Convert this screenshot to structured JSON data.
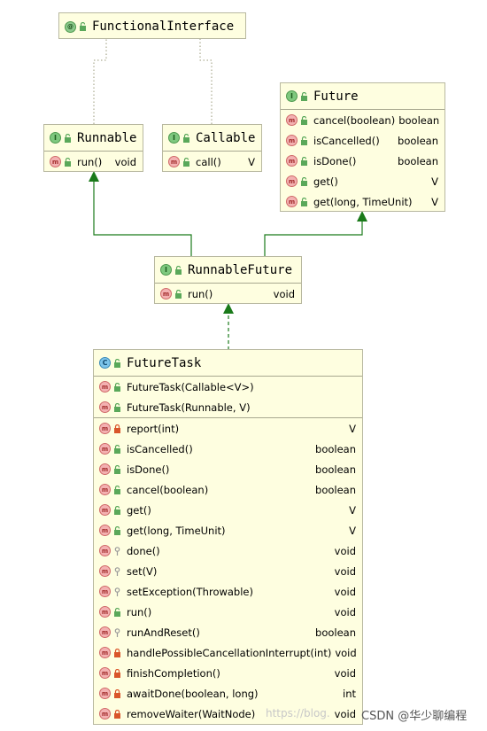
{
  "functional_interface": {
    "title": "FunctionalInterface"
  },
  "runnable": {
    "title": "Runnable",
    "methods": [
      {
        "name": "run()",
        "type": "void"
      }
    ]
  },
  "callable": {
    "title": "Callable",
    "methods": [
      {
        "name": "call()",
        "type": "V"
      }
    ]
  },
  "future": {
    "title": "Future",
    "methods": [
      {
        "name": "cancel(boolean)",
        "type": "boolean"
      },
      {
        "name": "isCancelled()",
        "type": "boolean"
      },
      {
        "name": "isDone()",
        "type": "boolean"
      },
      {
        "name": "get()",
        "type": "V"
      },
      {
        "name": "get(long, TimeUnit)",
        "type": "V"
      }
    ]
  },
  "runnable_future": {
    "title": "RunnableFuture",
    "methods": [
      {
        "name": "run()",
        "type": "void"
      }
    ]
  },
  "future_task": {
    "title": "FutureTask",
    "constructors": [
      {
        "name": "FutureTask(Callable<V>)"
      },
      {
        "name": "FutureTask(Runnable, V)"
      }
    ],
    "methods": [
      {
        "name": "report(int)",
        "type": "V",
        "visibility": "private"
      },
      {
        "name": "isCancelled()",
        "type": "boolean",
        "visibility": "public"
      },
      {
        "name": "isDone()",
        "type": "boolean",
        "visibility": "public"
      },
      {
        "name": "cancel(boolean)",
        "type": "boolean",
        "visibility": "public"
      },
      {
        "name": "get()",
        "type": "V",
        "visibility": "public"
      },
      {
        "name": "get(long, TimeUnit)",
        "type": "V",
        "visibility": "public"
      },
      {
        "name": "done()",
        "type": "void",
        "visibility": "protected"
      },
      {
        "name": "set(V)",
        "type": "void",
        "visibility": "protected"
      },
      {
        "name": "setException(Throwable)",
        "type": "void",
        "visibility": "protected"
      },
      {
        "name": "run()",
        "type": "void",
        "visibility": "public"
      },
      {
        "name": "runAndReset()",
        "type": "boolean",
        "visibility": "protected"
      },
      {
        "name": "handlePossibleCancellationInterrupt(int)",
        "type": "void",
        "visibility": "private"
      },
      {
        "name": "finishCompletion()",
        "type": "void",
        "visibility": "private"
      },
      {
        "name": "awaitDone(boolean, long)",
        "type": "int",
        "visibility": "private"
      },
      {
        "name": "removeWaiter(WaitNode)",
        "type": "void",
        "visibility": "private"
      }
    ]
  },
  "watermark": {
    "url": "https://blog.",
    "csdn": "CSDN @华少聊编程"
  },
  "icons": {
    "interface": "I",
    "class": "C",
    "annotation": "@",
    "method": "m"
  },
  "colors": {
    "box_fill": "#fefee0",
    "edge": "#1a7a1a",
    "annotation_link": "#9a9a7a"
  }
}
